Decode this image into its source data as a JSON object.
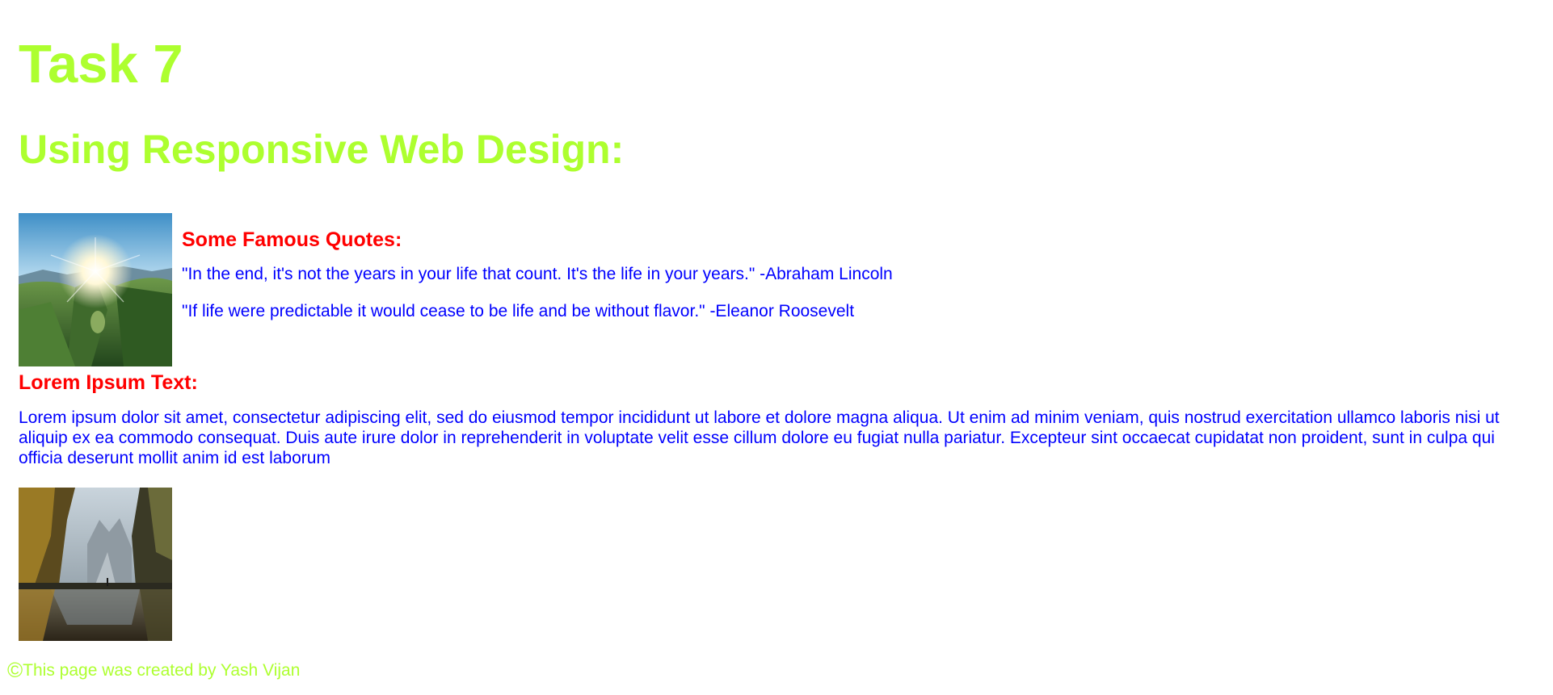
{
  "page": {
    "title": "Task 7",
    "subtitle": "Using Responsive Web Design:"
  },
  "images": [
    {
      "name": "mountain-sunrise-image",
      "subject": "sun over green mountain valley"
    },
    {
      "name": "forest-lake-image",
      "subject": "autumn forest reflected in lake"
    }
  ],
  "quotes": {
    "heading": "Some Famous Quotes:",
    "items": [
      "\"In the end, it's not the years in your life that count. It's the life in your years.\" -Abraham Lincoln",
      "\"If life were predictable it would cease to be life and be without flavor.\" -Eleanor Roosevelt"
    ]
  },
  "lorem": {
    "heading": "Lorem Ipsum Text:",
    "body": "Lorem ipsum dolor sit amet, consectetur adipiscing elit, sed do eiusmod tempor incididunt ut labore et dolore magna aliqua. Ut enim ad minim veniam, quis nostrud exercitation ullamco laboris nisi ut aliquip ex ea commodo consequat. Duis aute irure dolor in reprehenderit in voluptate velit esse cillum dolore eu fugiat nulla pariatur. Excepteur sint occaecat cupidatat non proident, sunt in culpa qui officia deserunt mollit anim id est laborum"
  },
  "footer": {
    "icon": "copyright-icon",
    "symbol": "©",
    "text": "This page was created by Yash Vijan"
  },
  "colors": {
    "heading_green": "#adff2f",
    "section_red": "#ff0000",
    "body_blue": "#0000ff",
    "background": "#ffffff"
  }
}
